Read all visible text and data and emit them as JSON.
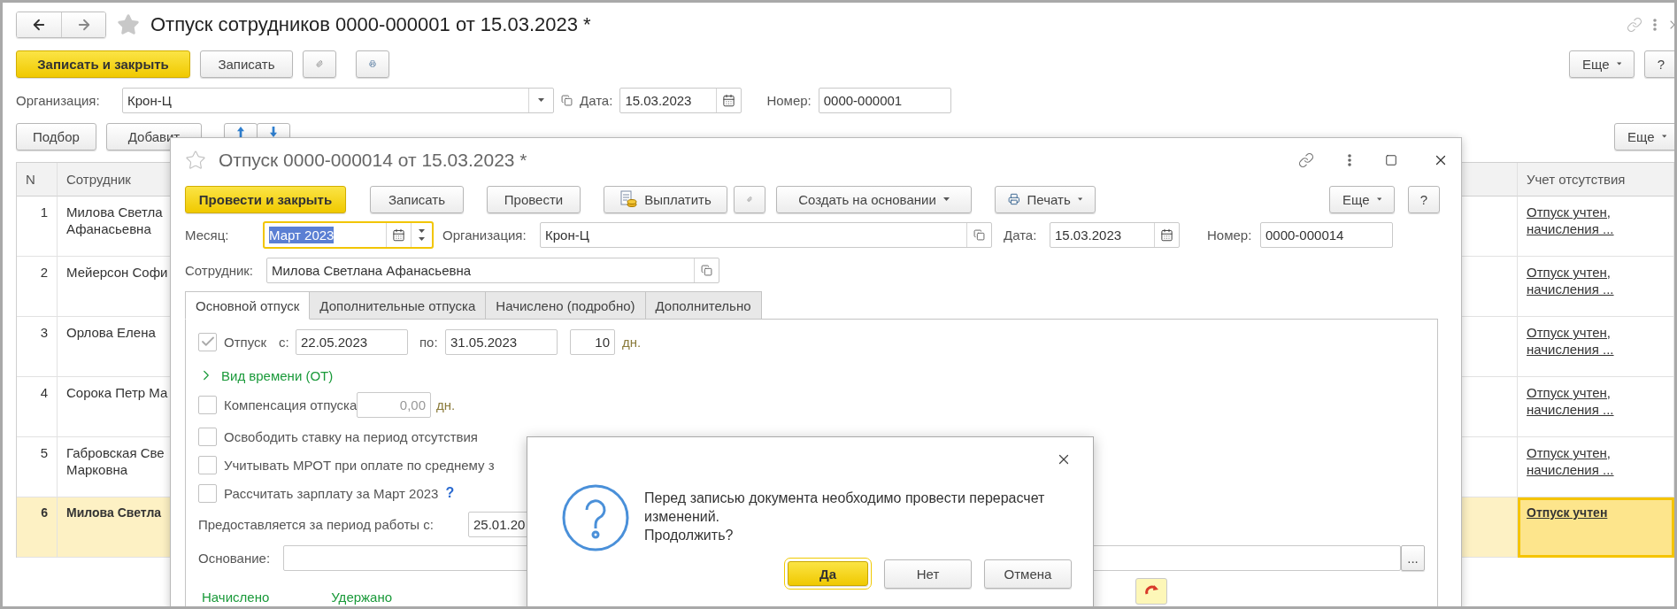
{
  "main_window": {
    "title": "Отпуск сотрудников 0000-000001 от 15.03.2023 *",
    "toolbar": {
      "primary": "Записать и закрыть",
      "save": "Записать",
      "more": "Еще",
      "help": "?"
    },
    "organization": {
      "label": "Организация:",
      "value": "Крон-Ц"
    },
    "date": {
      "label": "Дата:",
      "value": "15.03.2023"
    },
    "number": {
      "label": "Номер:",
      "value": "0000-000001"
    },
    "table_toolbar": {
      "pick": "Подбор",
      "add": "Добавит",
      "more": "Еще"
    },
    "table": {
      "columns": [
        "N",
        "Сотрудник",
        "Учет отсутствия"
      ],
      "rows": [
        {
          "n": "1",
          "employee": "Милова Светла\nАфанасьевна",
          "absence": "Отпуск учтен,\nначисления ...",
          "selected": false
        },
        {
          "n": "2",
          "employee": "Мейерсон Софи",
          "absence": "Отпуск учтен,\nначисления ...",
          "selected": false
        },
        {
          "n": "3",
          "employee": "Орлова Елена",
          "absence": "Отпуск учтен,\nначисления ...",
          "selected": false
        },
        {
          "n": "4",
          "employee": "Сорока Петр Ма",
          "absence": "Отпуск учтен,\nначисления ...",
          "selected": false
        },
        {
          "n": "5",
          "employee": "Габровская Све\nМарковна",
          "absence": "Отпуск учтен,\nначисления ...",
          "selected": false
        },
        {
          "n": "6",
          "employee": "Милова Светла",
          "absence": "Отпуск учтен",
          "selected": true
        }
      ]
    }
  },
  "document_window": {
    "title": "Отпуск 0000-000014 от 15.03.2023 *",
    "toolbar": [
      {
        "kind": "primary",
        "label": "Провести и закрыть"
      },
      {
        "kind": "plain",
        "label": "Записать"
      },
      {
        "kind": "plain",
        "label": "Провести"
      },
      {
        "kind": "pay",
        "label": "Выплатить"
      },
      {
        "kind": "attach"
      },
      {
        "kind": "menu",
        "label": "Создать на основании"
      },
      {
        "kind": "print",
        "label": "Печать"
      }
    ],
    "more": "Еще",
    "help": "?",
    "month": {
      "label": "Месяц:",
      "value": "Март 2023"
    },
    "organization": {
      "label": "Организация:",
      "value": "Крон-Ц"
    },
    "date": {
      "label": "Дата:",
      "value": "15.03.2023"
    },
    "number": {
      "label": "Номер:",
      "value": "0000-000014"
    },
    "employee": {
      "label": "Сотрудник:",
      "value": "Милова Светлана Афанасьевна"
    },
    "tabs": [
      {
        "label": "Основной отпуск",
        "selected": true
      },
      {
        "label": "Дополнительные отпуска",
        "selected": false
      },
      {
        "label": "Начислено (подробно)",
        "selected": false
      },
      {
        "label": "Дополнительно",
        "selected": false
      }
    ],
    "vacation": {
      "checked": true,
      "label": "Отпуск",
      "from_label": "с:",
      "from": "22.05.2023",
      "to_label": "по:",
      "to": "31.05.2023",
      "days": "10",
      "unit": "дн."
    },
    "time_kind": {
      "label": "Вид времени (ОТ)",
      "expanded": false
    },
    "compensation": {
      "checked": false,
      "label": "Компенсация отпуска",
      "value": "0,00",
      "unit": "дн."
    },
    "options": [
      {
        "checked": false,
        "label": "Освободить ставку на период отсутствия"
      },
      {
        "checked": false,
        "label": "Учитывать МРОТ при оплате по среднему з"
      },
      {
        "checked": false,
        "label": "Рассчитать зарплату за Март 2023",
        "hint": "?"
      }
    ],
    "period": {
      "label": "Предоставляется за период работы с:",
      "value": "25.01.20"
    },
    "basis": {
      "label": "Основание:",
      "button": "..."
    },
    "bottom_tabs": [
      "Начислено",
      "Удержано"
    ]
  },
  "dialog": {
    "message": "Перед записью документа необходимо провести перерасчет\nизменений.\nПродолжить?",
    "buttons": [
      {
        "label": "Да",
        "default": true
      },
      {
        "label": "Нет",
        "default": false
      },
      {
        "label": "Отмена",
        "default": false
      }
    ]
  }
}
